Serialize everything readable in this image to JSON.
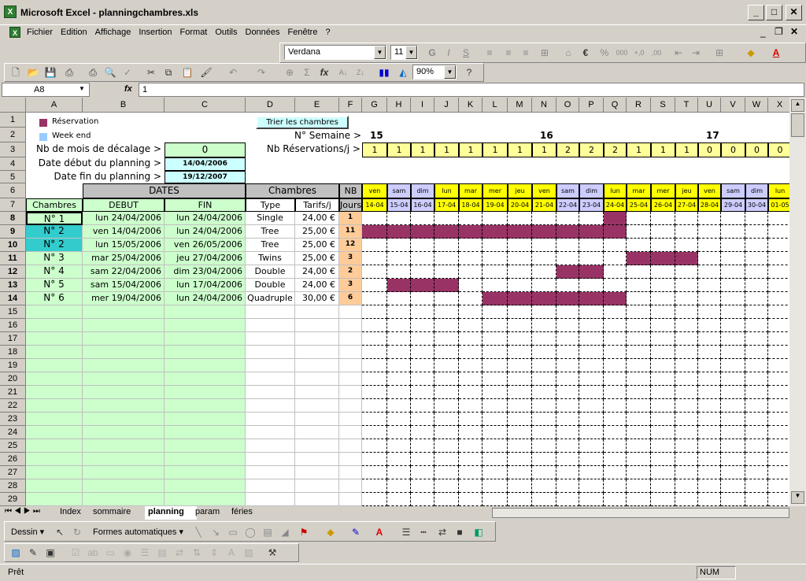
{
  "window": {
    "title": "Microsoft Excel - planningchambres.xls"
  },
  "menu": [
    "Fichier",
    "Edition",
    "Affichage",
    "Insertion",
    "Format",
    "Outils",
    "Données",
    "Fenêtre",
    "?"
  ],
  "format_toolbar": {
    "font": "Verdana",
    "size": "11"
  },
  "standard_toolbar": {
    "zoom": "90%"
  },
  "formula": {
    "cell": "A8",
    "fx": "fx",
    "value": "1"
  },
  "columns": [
    "A",
    "B",
    "C",
    "D",
    "E",
    "F",
    "G",
    "H",
    "I",
    "J",
    "K",
    "L",
    "M",
    "N",
    "O",
    "P",
    "Q",
    "R",
    "S",
    "T",
    "U",
    "V",
    "W",
    "X"
  ],
  "legend": {
    "reservation": "Réservation",
    "weekend": "Week end",
    "reservation_color": "#993366",
    "weekend_color": "#99ccff"
  },
  "sort_button": "Trier les chambres",
  "labels": {
    "week": "N° Semaine >",
    "offset": "Nb de mois de décalage >",
    "offset_val": "0",
    "nbres": "Nb Réservations/j >",
    "start": "Date début du planning >",
    "start_val": "14/04/2006",
    "end": "Date fin du planning >",
    "end_val": "19/12/2007"
  },
  "weeks": [
    {
      "label": "15"
    },
    {
      "label": "16"
    },
    {
      "label": "17"
    }
  ],
  "counts": [
    "1",
    "1",
    "1",
    "1",
    "1",
    "1",
    "1",
    "1",
    "2",
    "2",
    "2",
    "1",
    "1",
    "1",
    "0",
    "0",
    "0",
    "0"
  ],
  "headers": {
    "dates": "DATES",
    "chambres": "Chambres",
    "nb": "NB",
    "col_chambres": "Chambres",
    "debut": "DEBUT",
    "fin": "FIN",
    "type": "Type",
    "tarifs": "Tarifs/j",
    "jours": "Jours"
  },
  "days": [
    {
      "d": "ven",
      "dt": "14-04",
      "wk": false
    },
    {
      "d": "sam",
      "dt": "15-04",
      "wk": true
    },
    {
      "d": "dim",
      "dt": "16-04",
      "wk": true
    },
    {
      "d": "lun",
      "dt": "17-04",
      "wk": false
    },
    {
      "d": "mar",
      "dt": "18-04",
      "wk": false
    },
    {
      "d": "mer",
      "dt": "19-04",
      "wk": false
    },
    {
      "d": "jeu",
      "dt": "20-04",
      "wk": false
    },
    {
      "d": "ven",
      "dt": "21-04",
      "wk": false
    },
    {
      "d": "sam",
      "dt": "22-04",
      "wk": true
    },
    {
      "d": "dim",
      "dt": "23-04",
      "wk": true
    },
    {
      "d": "lun",
      "dt": "24-04",
      "wk": false
    },
    {
      "d": "mar",
      "dt": "25-04",
      "wk": false
    },
    {
      "d": "mer",
      "dt": "26-04",
      "wk": false
    },
    {
      "d": "jeu",
      "dt": "27-04",
      "wk": false
    },
    {
      "d": "ven",
      "dt": "28-04",
      "wk": false
    },
    {
      "d": "sam",
      "dt": "29-04",
      "wk": true
    },
    {
      "d": "dim",
      "dt": "30-04",
      "wk": true
    },
    {
      "d": "lun",
      "dt": "01-05",
      "wk": false
    }
  ],
  "bookings": [
    {
      "row": "8",
      "room": "N° 1",
      "debut": "lun 24/04/2006",
      "fin": "lun 24/04/2006",
      "type": "Single",
      "tarif": "24,00 €",
      "jours": "1",
      "hl": false,
      "from": 10,
      "to": 10
    },
    {
      "row": "9",
      "room": "N° 2",
      "debut": "ven 14/04/2006",
      "fin": "lun 24/04/2006",
      "type": "Tree",
      "tarif": "25,00 €",
      "jours": "11",
      "hl": true,
      "from": 0,
      "to": 10
    },
    {
      "row": "10",
      "room": "N° 2",
      "debut": "lun 15/05/2006",
      "fin": "ven 26/05/2006",
      "type": "Tree",
      "tarif": "25,00 €",
      "jours": "12",
      "hl": true,
      "from": -1,
      "to": -1
    },
    {
      "row": "11",
      "room": "N° 3",
      "debut": "mar 25/04/2006",
      "fin": "jeu 27/04/2006",
      "type": "Twins",
      "tarif": "25,00 €",
      "jours": "3",
      "hl": false,
      "from": 11,
      "to": 13
    },
    {
      "row": "12",
      "room": "N° 4",
      "debut": "sam 22/04/2006",
      "fin": "dim 23/04/2006",
      "type": "Double",
      "tarif": "24,00 €",
      "jours": "2",
      "hl": false,
      "from": 8,
      "to": 9
    },
    {
      "row": "13",
      "room": "N° 5",
      "debut": "sam 15/04/2006",
      "fin": "lun 17/04/2006",
      "type": "Double",
      "tarif": "24,00 €",
      "jours": "3",
      "hl": false,
      "from": 1,
      "to": 3
    },
    {
      "row": "14",
      "room": "N° 6",
      "debut": "mer 19/04/2006",
      "fin": "lun 24/04/2006",
      "type": "Quadruple",
      "tarif": "30,00 €",
      "jours": "6",
      "hl": false,
      "from": 5,
      "to": 10
    }
  ],
  "empty_rows": [
    "15",
    "16",
    "17",
    "18",
    "19",
    "20",
    "21",
    "22",
    "23",
    "24",
    "25",
    "26",
    "27",
    "28",
    "29"
  ],
  "top_rows": [
    "1",
    "2",
    "3",
    "4",
    "5",
    "6",
    "7"
  ],
  "sheets": [
    "Index",
    "sommaire",
    "planning",
    "param",
    "féries"
  ],
  "drawing": {
    "dessin": "Dessin",
    "formes": "Formes automatiques"
  },
  "status": {
    "ready": "Prêt",
    "num": "NUM"
  }
}
